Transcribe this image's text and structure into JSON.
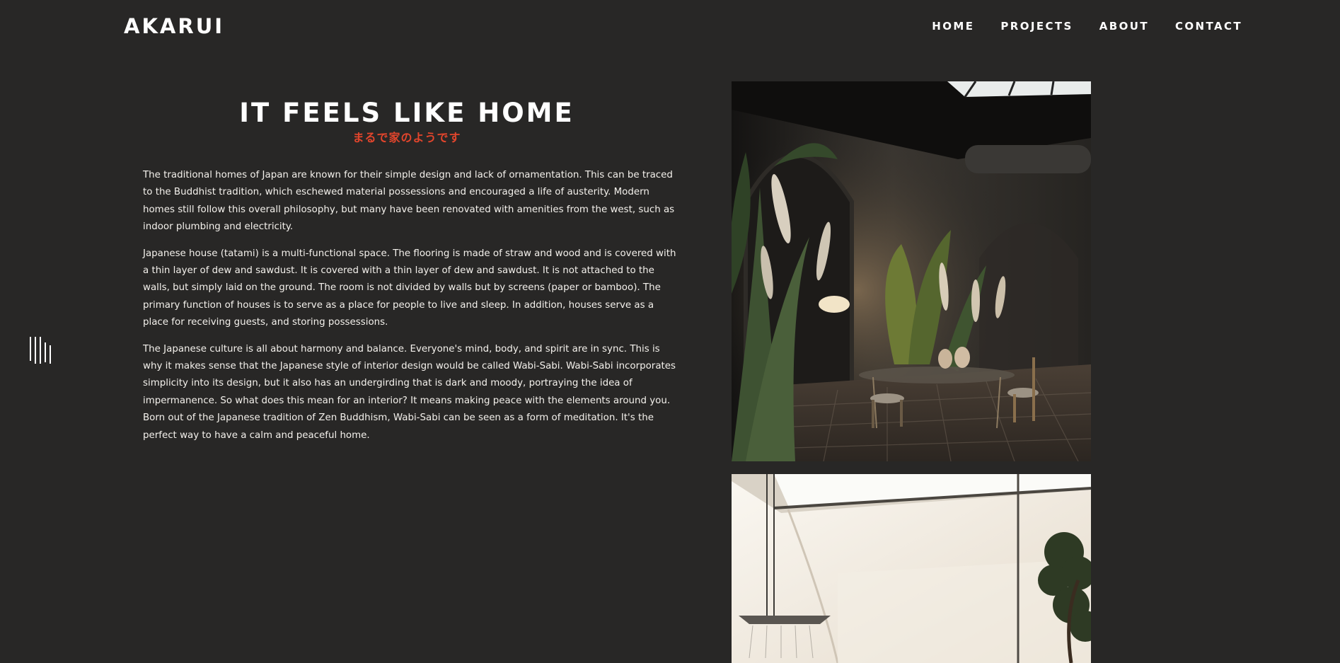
{
  "header": {
    "logo": "AKARUI",
    "nav": [
      "HOME",
      "PROJECTS",
      "ABOUT",
      "CONTACT"
    ]
  },
  "hero": {
    "title": "IT FEELS LIKE HOME",
    "subtitle": "まるで家のようです",
    "accent_color": "#e2452c"
  },
  "content": {
    "paragraphs": [
      "The traditional homes of Japan are known for their simple design and lack of ornamentation. This can be traced to the Buddhist tradition, which eschewed material possessions and encouraged a life of austerity. Modern homes still follow this overall philosophy, but many have been renovated with amenities from the west, such as indoor plumbing and electricity.",
      "Japanese house (tatami) is a multi-functional space. The flooring is made of straw and wood and is covered with a thin layer of dew and sawdust. It is covered with a thin layer of dew and sawdust. It is not attached to the walls, but simply laid on the ground. The room is not divided by walls but by screens (paper or bamboo). The primary function of houses is to serve as a place for people to live and sleep. In addition, houses serve as a place for receiving guests, and storing possessions.",
      "The Japanese culture is all about harmony and balance. Everyone's mind, body, and spirit are in sync. This is why it makes sense that the Japanese style of interior design would be called Wabi-Sabi. Wabi-Sabi incorporates simplicity into its design, but it also has an undergirding that is dark and moody, portraying the idea of impermanence. So what does this mean for an interior? It means making peace with the elements around you. Born out of the Japanese tradition of Zen Buddhism, Wabi-Sabi can be seen as a form of meditation. It's the perfect way to have a calm and peaceful home."
    ]
  },
  "side_menu": {
    "icon": "menu-lines-icon"
  },
  "colors": {
    "background": "#282726",
    "text": "#ffffff"
  }
}
